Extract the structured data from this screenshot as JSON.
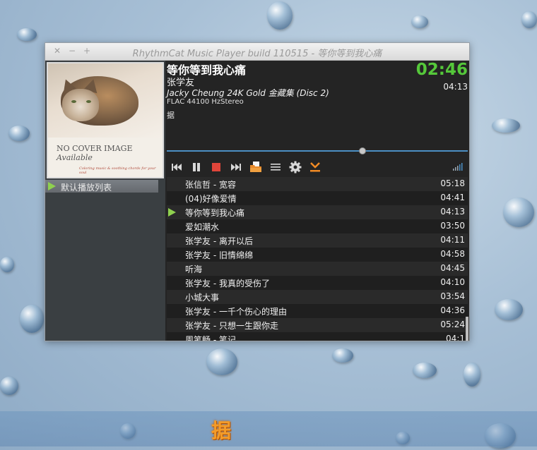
{
  "window": {
    "title": "RhythmCat Music Player build 110515 - 等你等到我心痛",
    "controls": [
      "close-icon",
      "minimize-icon",
      "maximize-icon"
    ]
  },
  "cover": {
    "line1": "NO COVER IMAGE",
    "line2": "Available",
    "line3": "Coloring music & soothing chords for your soul"
  },
  "sidebar": {
    "playlists": [
      {
        "label": "默认播放列表"
      }
    ]
  },
  "now_playing": {
    "title": "等你等到我心痛",
    "artist": "张学友",
    "album": "Jacky Cheung 24K Gold 金藏集 (Disc 2)",
    "format": "FLAC 44100 HzStereo",
    "lyric": "据",
    "elapsed": "02:46",
    "duration": "04:13",
    "progress_fraction": 0.65
  },
  "toolbar": {
    "buttons": [
      "previous-icon",
      "pause-icon",
      "stop-icon",
      "next-icon",
      "open-folder-icon",
      "playlist-menu-icon",
      "settings-icon",
      "download-icon",
      "volume-icon"
    ]
  },
  "tracks": [
    {
      "name": "张信哲 - 宽容",
      "duration": "05:18",
      "playing": false
    },
    {
      "name": "(04)好像爱情",
      "duration": "04:41",
      "playing": false
    },
    {
      "name": "等你等到我心痛",
      "duration": "04:13",
      "playing": true
    },
    {
      "name": "爱如潮水",
      "duration": "03:50",
      "playing": false
    },
    {
      "name": "张学友 - 离开以后",
      "duration": "04:11",
      "playing": false
    },
    {
      "name": "张学友 - 旧情绵绵",
      "duration": "04:58",
      "playing": false
    },
    {
      "name": "听海",
      "duration": "04:45",
      "playing": false
    },
    {
      "name": "张学友 - 我真的受伤了",
      "duration": "04:10",
      "playing": false
    },
    {
      "name": "小城大事",
      "duration": "03:54",
      "playing": false
    },
    {
      "name": "张学友 - 一千个伤心的理由",
      "duration": "04:36",
      "playing": false
    },
    {
      "name": "张学友 - 只想一生跟你走",
      "duration": "05:24",
      "playing": false
    },
    {
      "name": "周笔畅 - 笔记",
      "duration": "04:1",
      "playing": false
    }
  ],
  "desktop_lyric": "据",
  "colors": {
    "accent_green": "#55c83a",
    "seek_blue": "#4b8fc4",
    "stop_red": "#e0453a",
    "lyric_orange": "#f39c2a"
  }
}
